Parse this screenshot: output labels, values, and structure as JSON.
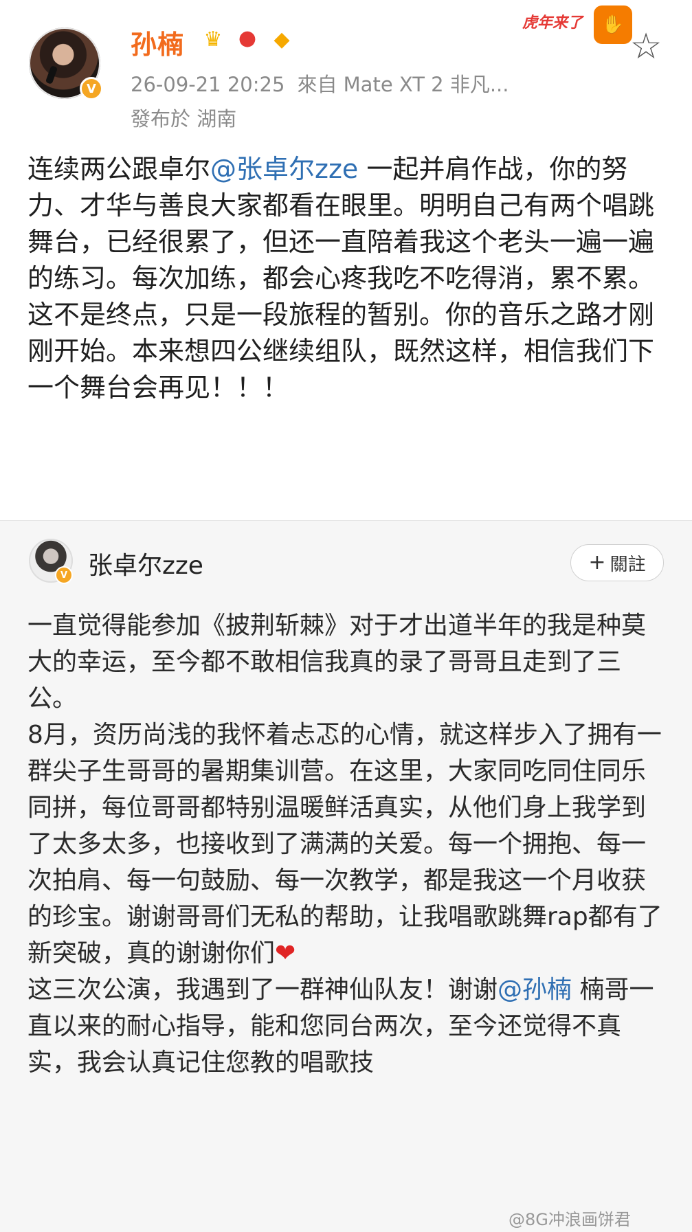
{
  "post": {
    "username": "孙楠",
    "badges": [
      "crown-icon",
      "bird-icon",
      "fish-icon"
    ],
    "meta_time": "26-09-21 20:25",
    "meta_source": "來自 Mate XT 2 非凡...",
    "location": "發布於 湖南",
    "sticker_text": "虎年来了",
    "text_before_mention": "连续两公跟卓尔",
    "mention": "@张卓尔zze",
    "text_after_mention": " 一起并肩作战，你的努力、才华与善良大家都看在眼里。明明自己有两个唱跳舞台，已经很累了，但还一直陪着我这个老头一遍一遍的练习。每次加练，都会心疼我吃不吃得消，累不累。这不是终点，只是一段旅程的暂别。你的音乐之路才刚刚开始。本来想四公继续组队，既然这样，相信我们下一个舞台会再见！！！"
  },
  "repost": {
    "username": "张卓尔zze",
    "follow_label": "關註",
    "paragraph1": "一直觉得能参加《披荆斩棘》对于才出道半年的我是种莫大的幸运，至今都不敢相信我真的录了哥哥且走到了三公。",
    "paragraph2": "8月，资历尚浅的我怀着忐忑的心情，就这样步入了拥有一群尖子生哥哥的暑期集训营。在这里，大家同吃同住同乐同拼，每位哥哥都特别温暖鲜活真实，从他们身上我学到了太多太多，也接收到了满满的关爱。每一个拥抱、每一次拍肩、每一句鼓励、每一次教学，都是我这一个月收获的珍宝。谢谢哥哥们无私的帮助，让我唱歌跳舞rap都有了新突破，真的谢谢你们",
    "paragraph3_before_mention": "这三次公演，我遇到了一群神仙队友！谢谢",
    "paragraph3_mention": "@孙楠",
    "paragraph3_after_mention": " 楠哥一直以来的耐心指导，能和您同台两次，至今还觉得不真实，我会认真记住您教的唱歌技"
  },
  "watermark": "@8G冲浪画饼君"
}
